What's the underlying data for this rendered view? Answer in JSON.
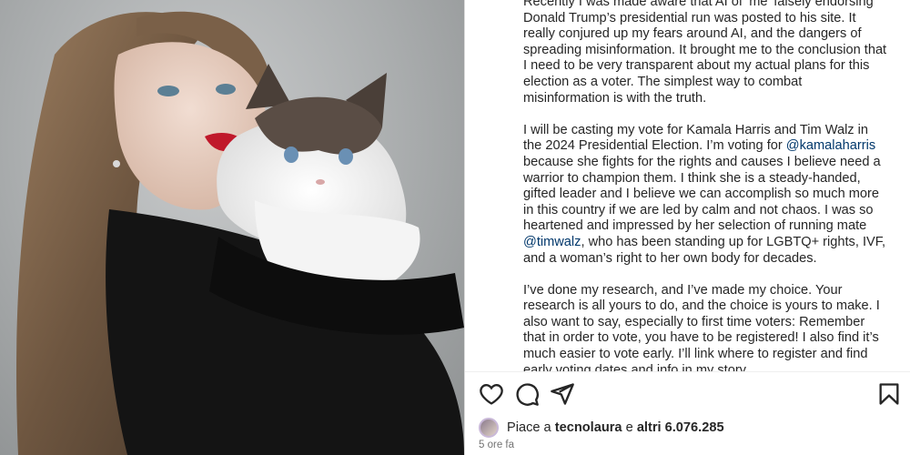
{
  "post": {
    "image_alt": "Woman with long wavy hair and red lipstick holding a ragdoll cat",
    "caption": {
      "p1": "Recently I was made aware that AI of ‘me’ falsely endorsing Donald Trump’s presidential run was posted to his site. It really conjured up my fears around AI, and the dangers of spreading misinformation. It brought me to the conclusion that I need to be very transparent about my actual plans for this election as a voter. The simplest way to combat misinformation is with the truth.",
      "p2_a": "I will be casting my vote for Kamala Harris and Tim Walz in the 2024 Presidential Election. I’m voting for ",
      "mention1": "@kamalaharris",
      "p2_b": " because she fights for the rights and causes I believe need a warrior to champion them. I think she is a steady-handed, gifted leader and I believe we can accomplish so much more in this country if we are led by calm and not chaos. I was so heartened and impressed by her selection of running mate ",
      "mention2": "@timwalz",
      "p2_c": ", who has been standing up for LGBTQ+ rights, IVF, and a woman’s right to her own body for decades.",
      "p3": "I’ve done my research, and I’ve made my choice. Your research is all yours to do, and the choice is yours to make. I also want to say, especially to first time voters: Remember that in order to vote, you have to be registered! I also find it’s much easier to vote early. I’ll link where to register and find early voting dates and info in my story."
    },
    "actions": {
      "like_icon": "heart-icon",
      "comment_icon": "comment-icon",
      "share_icon": "send-icon",
      "save_icon": "bookmark-icon"
    },
    "likes": {
      "prefix": "Piace a",
      "user": "tecnolaura",
      "middle": "e",
      "others": "altri 6.076.285"
    },
    "timestamp": "5 ore fa"
  }
}
